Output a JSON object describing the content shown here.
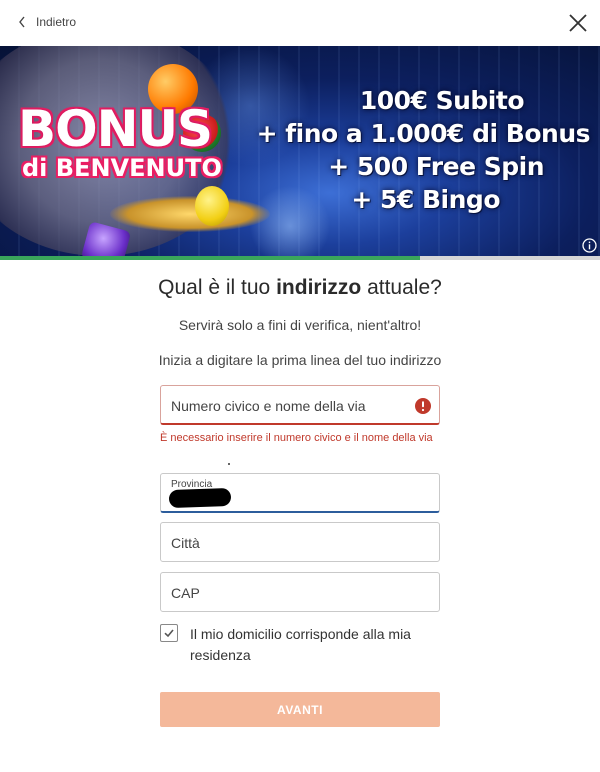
{
  "header": {
    "back_label": "Indietro"
  },
  "banner": {
    "bonus_title": "BONUS",
    "bonus_subtitle": "di BENVENUTO",
    "promo_lines": [
      "100€ Subito",
      "+ fino a 1.000€ di Bonus",
      "+ 500 Free Spin",
      "+ 5€ Bingo"
    ]
  },
  "progress": {
    "fraction": 0.7,
    "color": "#3aa65b"
  },
  "form": {
    "heading_pre": "Qual è il tuo ",
    "heading_bold": "indirizzo",
    "heading_post": " attuale?",
    "subtitle": "Servirà solo a fini di verifica, nient'altro!",
    "hint": "Inizia a digitare la prima linea del tuo indirizzo",
    "street_placeholder": "Numero civico e nome della via",
    "street_error": "È necessario inserire il numero civico e il nome della via",
    "province_label": "Provincia",
    "city_placeholder": "Città",
    "cap_placeholder": "CAP",
    "residence_checkbox_label": "Il mio domicilio corrisponde alla mia residenza",
    "residence_checked": true,
    "submit_label": "AVANTI"
  },
  "colors": {
    "error": "#c0392b",
    "button": "#f4b89a",
    "active_border": "#2c5d9c"
  }
}
